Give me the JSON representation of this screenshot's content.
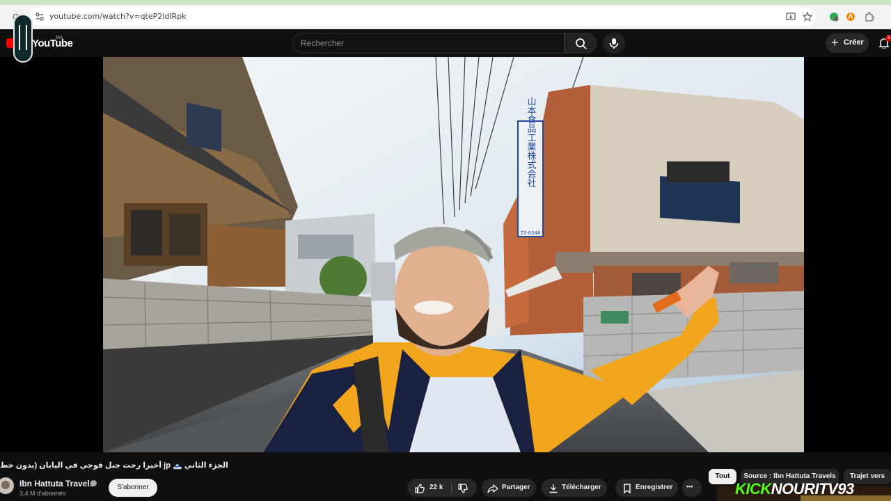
{
  "browser": {
    "url": "youtube.com/watch?v=qteP2ldIRpk"
  },
  "header": {
    "logo_text": "YouTube",
    "country_code": "MA",
    "search_placeholder": "Rechercher",
    "create_label": "Créer",
    "notification_count": "9"
  },
  "video": {
    "title": "الجزء الثاني 🗻 jp أخيرا رحت جبل فوجي في اليابان (بدون خط",
    "sign_text": "山本食品工業株式会社",
    "sign_phone": "72-0046"
  },
  "channel": {
    "name": "Ibn Hattuta Travels",
    "subscribers": "3,4 M d'abonnés",
    "subscribe_label": "S'abonner"
  },
  "actions": {
    "like_count": "22 k",
    "share_label": "Partager",
    "download_label": "Télécharger",
    "save_label": "Enregistrer",
    "more_label": "•••"
  },
  "chips": [
    {
      "label": "Tout"
    },
    {
      "label": "Source : Ibn Hattuta Travels"
    },
    {
      "label": "Trajet vers"
    }
  ],
  "overlay": {
    "kick_prefix": "KICK",
    "kick_name": "NOURITV93"
  },
  "colors": {
    "background": "#0f0f0f",
    "yt_red": "#ff0000",
    "kick_green": "#53fc18",
    "jacket": "#f2a900"
  }
}
